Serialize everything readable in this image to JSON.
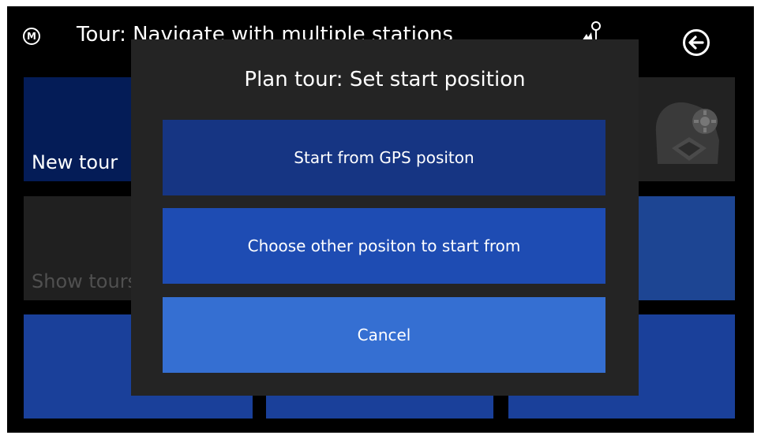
{
  "header": {
    "logo_letter": "M",
    "title": "Tour: Navigate with multiple stations",
    "gps_icon": "satellite-icon",
    "back_icon": "back-arrow-icon"
  },
  "tiles": {
    "new_tour_label": "New tour",
    "show_tours_label": "Show tours",
    "settings_icon": "settings-gear-icon"
  },
  "dialog": {
    "title": "Plan tour: Set start position",
    "buttons": {
      "gps": "Start from GPS positon",
      "other": "Choose other positon to start from",
      "cancel": "Cancel"
    }
  },
  "colors": {
    "background": "#000000",
    "dialog_bg": "#242424",
    "button_gps": "#163583",
    "button_other": "#1e4cb3",
    "button_cancel": "#356fd2",
    "tile_blue": "#1a409a"
  }
}
